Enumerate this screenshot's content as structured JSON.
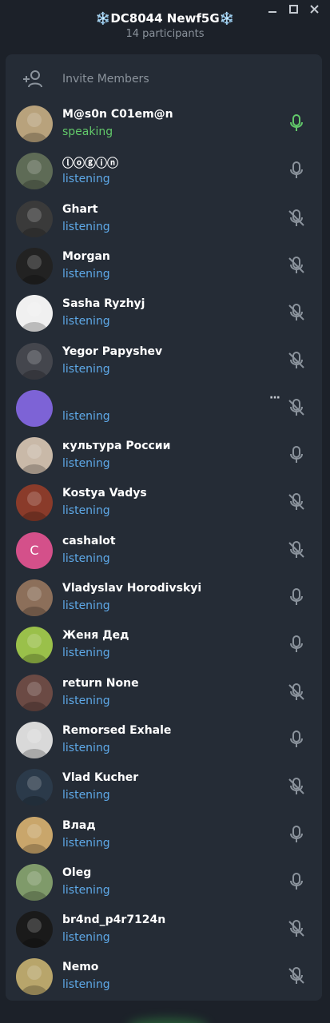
{
  "header": {
    "title": "❄️DC8044 Newf5G❄️",
    "subtitle": "14 participants"
  },
  "window_controls": {
    "minimize_icon": "minimize-icon",
    "maximize_icon": "maximize-icon",
    "close_icon": "close-icon"
  },
  "invite": {
    "label": "Invite Members",
    "icon": "add-user-icon"
  },
  "colors": {
    "speaking": "#62c96a",
    "listening": "#5ea9e8",
    "panel": "#252c36",
    "background": "#1c2129"
  },
  "participants": [
    {
      "name": "M@s0n C01em@n",
      "status": "speaking",
      "mic": "mic-active-icon",
      "avatar": "#b8a27c"
    },
    {
      "name": "ⓛⓞⓖⓘⓝ",
      "status": "listening",
      "mic": "mic-icon",
      "avatar": "#5e6b56"
    },
    {
      "name": "Ghart",
      "status": "listening",
      "mic": "mic-muted-icon",
      "avatar": "#3a3a3a"
    },
    {
      "name": "Morgan",
      "status": "listening",
      "mic": "mic-muted-icon",
      "avatar": "#222222"
    },
    {
      "name": "Sasha Ryzhyj",
      "status": "listening",
      "mic": "mic-muted-icon",
      "avatar": "#f0f0f0"
    },
    {
      "name": "Yegor Papyshev",
      "status": "listening",
      "mic": "mic-muted-icon",
      "avatar": "#44464d"
    },
    {
      "name": "",
      "status": "listening",
      "mic": "mic-muted-icon",
      "avatar": "#7d63d6",
      "more": "···"
    },
    {
      "name": "культура России",
      "status": "listening",
      "mic": "mic-icon",
      "avatar": "#c9b9a8"
    },
    {
      "name": "Kostya Vadys",
      "status": "listening",
      "mic": "mic-muted-icon",
      "avatar": "#8a3b2a"
    },
    {
      "name": "cashalot",
      "status": "listening",
      "mic": "mic-muted-icon",
      "avatar": "#d4508a",
      "letter": "C"
    },
    {
      "name": "Vladyslav Horodivskyi",
      "status": "listening",
      "mic": "mic-icon",
      "avatar": "#8c6f5a"
    },
    {
      "name": "Женя Дед",
      "status": "listening",
      "mic": "mic-icon",
      "avatar": "#9ac04a"
    },
    {
      "name": "return None",
      "status": "listening",
      "mic": "mic-muted-icon",
      "avatar": "#6b4a44"
    },
    {
      "name": "Remorsed Exhale",
      "status": "listening",
      "mic": "mic-icon",
      "avatar": "#d9d9d9"
    },
    {
      "name": "Vlad Kucher",
      "status": "listening",
      "mic": "mic-muted-icon",
      "avatar": "#2b3a4a"
    },
    {
      "name": "Влад",
      "status": "listening",
      "mic": "mic-icon",
      "avatar": "#c9a66b"
    },
    {
      "name": "Oleg",
      "status": "listening",
      "mic": "mic-icon",
      "avatar": "#7f9a6a"
    },
    {
      "name": "br4nd_p4r7124n",
      "status": "listening",
      "mic": "mic-muted-icon",
      "avatar": "#1a1a1a"
    },
    {
      "name": "Nemo",
      "status": "listening",
      "mic": "mic-muted-icon",
      "avatar": "#b8a56b"
    }
  ]
}
